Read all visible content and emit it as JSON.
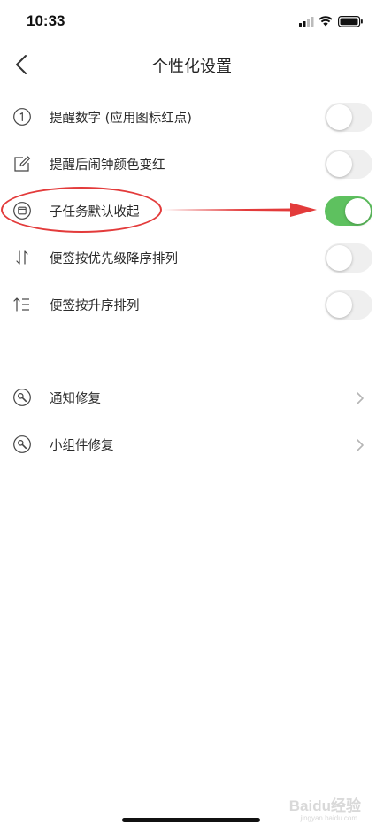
{
  "status_bar": {
    "time": "10:33"
  },
  "header": {
    "title": "个性化设置"
  },
  "settings": [
    {
      "label": "提醒数字 (应用图标红点)",
      "icon": "number-one-circle-icon",
      "toggle_on": false
    },
    {
      "label": "提醒后闹钟颜色变红",
      "icon": "edit-pencil-icon",
      "toggle_on": false
    },
    {
      "label": "子任务默认收起",
      "icon": "collapse-window-icon",
      "toggle_on": true
    },
    {
      "label": "便签按优先级降序排列",
      "icon": "sort-arrows-icon",
      "toggle_on": false
    },
    {
      "label": "便签按升序排列",
      "icon": "sort-ascending-icon",
      "toggle_on": false
    }
  ],
  "repairs": [
    {
      "label": "通知修复",
      "icon": "wrench-icon"
    },
    {
      "label": "小组件修复",
      "icon": "wrench-icon"
    }
  ],
  "watermark": {
    "text": "Baidu经验",
    "sub": "jingyan.baidu.com"
  },
  "colors": {
    "toggle_on": "#5ec15f",
    "toggle_off": "#efefef",
    "annotation": "#e33b3b"
  }
}
